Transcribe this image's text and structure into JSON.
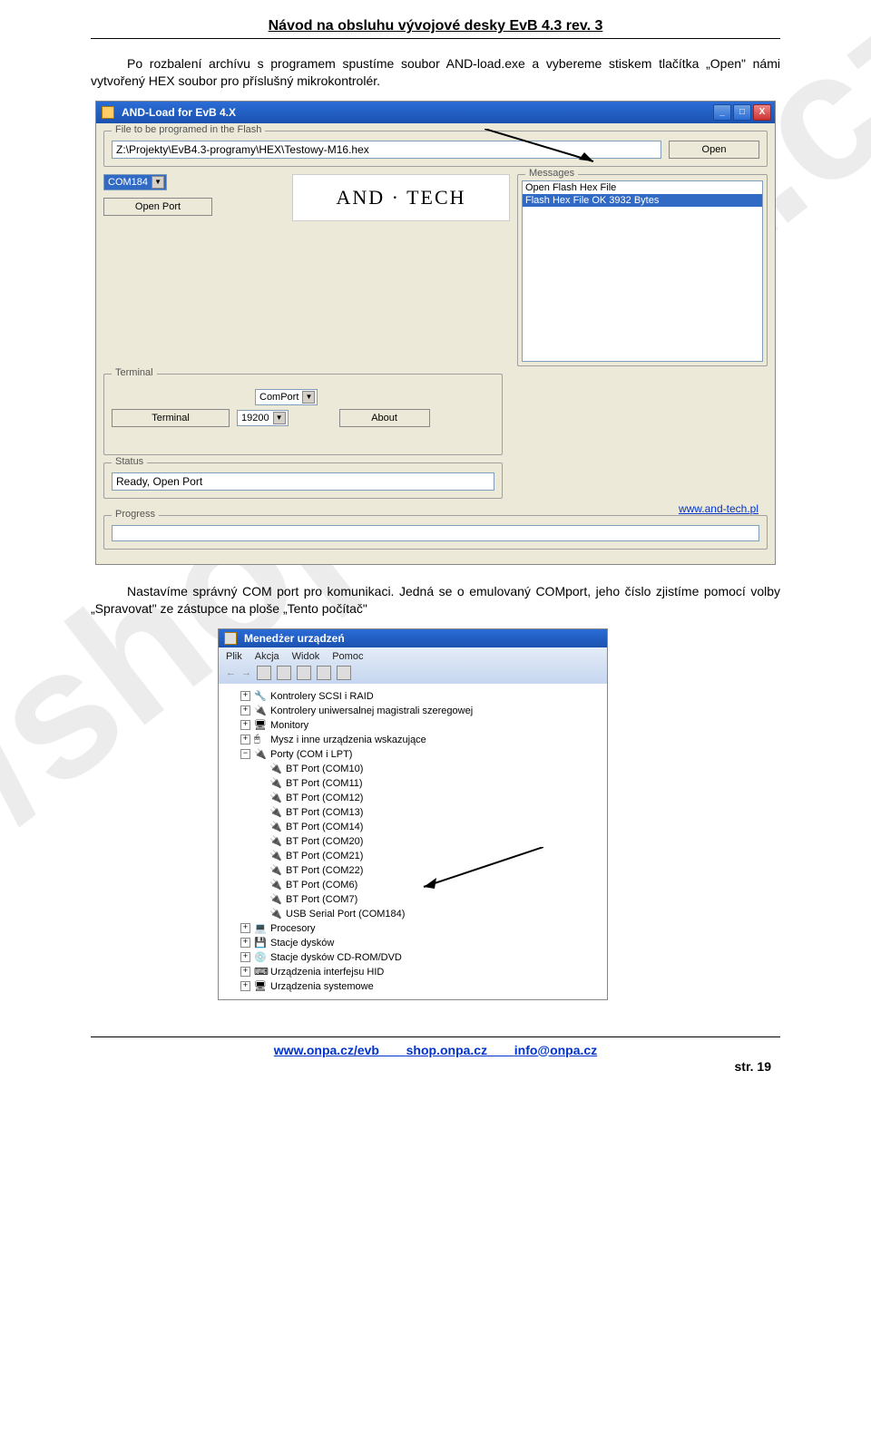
{
  "header": {
    "title": "Návod na obsluhu vývojové desky EvB 4.3 rev. 3"
  },
  "para1": "Po rozbalení archívu s programem spustíme soubor AND-load.exe a vybereme stiskem tlačítka „Open\" námi vytvořený HEX soubor pro příslušný mikrokontrolér.",
  "window1": {
    "title": "AND-Load for EvB 4.X",
    "minLabel": "_",
    "maxLabel": "□",
    "closeLabel": "X",
    "flashGroup": "File to be programed in the Flash",
    "flashPath": "Z:\\Projekty\\EvB4.3-programy\\HEX\\Testowy-M16.hex",
    "openBtn": "Open",
    "comValue": "COM184",
    "openPortBtn": "Open Port",
    "logoText": "AND · TECH",
    "messagesGroup": "Messages",
    "msg1": "Open Flash Hex File",
    "msg2": "Flash Hex File OK 3932 Bytes",
    "terminalGroup": "Terminal",
    "terminalBtn": "Terminal",
    "comPortLabel": "ComPort",
    "baud": "19200",
    "aboutBtn": "About",
    "statusGroup": "Status",
    "statusValue": "Ready, Open Port",
    "progressGroup": "Progress",
    "link": "www.and-tech.pl"
  },
  "para2": "Nastavíme správný COM port pro komunikaci. Jedná se o emulovaný COMport, jeho číslo zjistíme pomocí volby „Spravovat\" ze zástupce na ploše „Tento počítač\"",
  "window2": {
    "title": "Menedżer urządzeń",
    "menuPlik": "Plik",
    "menuAkcja": "Akcja",
    "menuWidok": "Widok",
    "menuPomoc": "Pomoc",
    "arrowL": "←",
    "arrowR": "→",
    "tree": {
      "n1": "Kontrolery SCSI i RAID",
      "n2": "Kontrolery uniwersalnej magistrali szeregowej",
      "n3": "Monitory",
      "n4": "Mysz i inne urządzenia wskazujące",
      "n5": "Porty (COM i LPT)",
      "p1": "BT Port (COM10)",
      "p2": "BT Port (COM11)",
      "p3": "BT Port (COM12)",
      "p4": "BT Port (COM13)",
      "p5": "BT Port (COM14)",
      "p6": "BT Port (COM20)",
      "p7": "BT Port (COM21)",
      "p8": "BT Port (COM22)",
      "p9": "BT Port (COM6)",
      "p10": "BT Port (COM7)",
      "p11": "USB Serial Port (COM184)",
      "n6": "Procesory",
      "n7": "Stacje dysków",
      "n8": "Stacje dysków CD-ROM/DVD",
      "n9": "Urządzenia interfejsu HID",
      "n10": "Urządzenia systemowe"
    }
  },
  "footer": {
    "l1": "www.onpa.cz/evb",
    "l2": "shop.onpa.cz",
    "l3": "info@onpa.cz",
    "page": "str. 19"
  },
  "watermark": "http://shop.onpa.cz"
}
